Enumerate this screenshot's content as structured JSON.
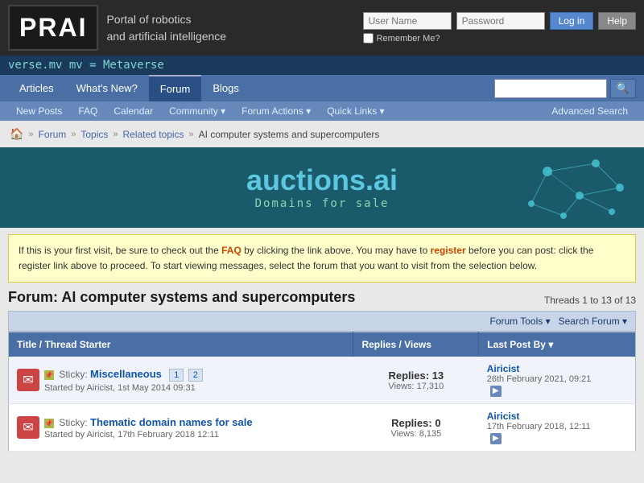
{
  "site": {
    "logo": "PRAI",
    "tagline1": "Portal of robotics",
    "tagline2": "and artificial intelligence"
  },
  "auth": {
    "username_placeholder": "User Name",
    "password_placeholder": "Password",
    "login_btn": "Log in",
    "help_btn": "Help",
    "remember_label": "Remember Me?"
  },
  "marquee": "verse.mv  mv = Metaverse",
  "nav": {
    "items": [
      "Articles",
      "What's New?",
      "Forum",
      "Blogs"
    ],
    "active": "Forum",
    "search_placeholder": ""
  },
  "subnav": {
    "items": [
      "New Posts",
      "FAQ",
      "Calendar",
      "Community ▾",
      "Forum Actions ▾",
      "Quick Links ▾"
    ],
    "right": "Advanced Search"
  },
  "breadcrumb": {
    "home": "🏠",
    "items": [
      "Forum",
      "Topics",
      "Related topics",
      "AI computer systems and supercomputers"
    ]
  },
  "banner": {
    "title": "auctions.ai",
    "subtitle": "Domains  for  sale"
  },
  "notice": {
    "text1": "If this is your first visit, be sure to check out the ",
    "faq_link": "FAQ",
    "text2": " by clicking the link above. You may have to ",
    "register_link": "register",
    "text3": " before you can post: click the register link above to proceed. To start viewing messages, select the forum that you want to visit from the selection below."
  },
  "forum": {
    "title": "Forum: AI computer systems and supercomputers",
    "thread_count": "Threads 1 to 13 of 13",
    "toolbar": {
      "forum_tools": "Forum Tools ▾",
      "search_forum": "Search Forum ▾"
    },
    "table": {
      "headers": {
        "title": "Title / Thread Starter",
        "replies": "Replies / Views",
        "lastpost": "Last Post By ▾"
      },
      "rows": [
        {
          "sticky": true,
          "title": "Miscellaneous",
          "starter": "Started by Airicist, 1st May 2014 09:31",
          "pages": [
            "1",
            "2"
          ],
          "replies": "13",
          "views": "17,310",
          "lastpost_author": "Airicist",
          "lastpost_date": "26th February 2021, 09:21",
          "has_arrow": true
        },
        {
          "sticky": true,
          "title": "Thematic domain names for sale",
          "starter": "Started by Airicist, 17th February 2018 12:11",
          "pages": [],
          "replies": "0",
          "views": "8,135",
          "lastpost_author": "Airicist",
          "lastpost_date": "17th February 2018, 12:11",
          "has_arrow": true
        }
      ]
    }
  }
}
